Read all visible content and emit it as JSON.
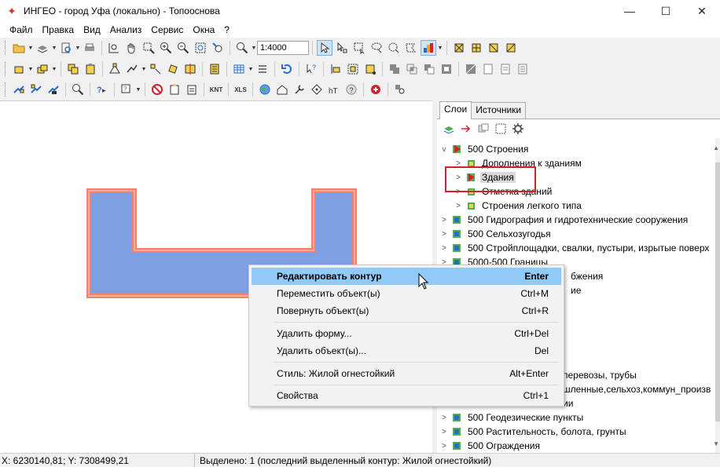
{
  "window": {
    "title": "ИНГЕО - город Уфа (локально) - Топооснова",
    "minimize": "—",
    "maximize": "☐",
    "close": "✕"
  },
  "menu": [
    "Файл",
    "Правка",
    "Вид",
    "Анализ",
    "Сервис",
    "Окна",
    "?"
  ],
  "toolbar": {
    "scale": "1:4000",
    "xls_label": "XLS",
    "knt_label": "KNT"
  },
  "panel": {
    "tabs": [
      "Слои",
      "Источники"
    ],
    "tree": [
      {
        "label": "500 Строения",
        "level": 0,
        "chevron": "down"
      },
      {
        "label": "Дополнения к зданиям",
        "level": 1,
        "chevron": "right"
      },
      {
        "label": "Здания",
        "level": 1,
        "chevron": "right",
        "selected": true
      },
      {
        "label": "Отметка зданий",
        "level": 1,
        "chevron": "right"
      },
      {
        "label": "Строения легкого типа",
        "level": 1,
        "chevron": "right"
      },
      {
        "label": "500 Гидрография и гидротехнические сооружения",
        "level": 0,
        "chevron": "right"
      },
      {
        "label": "500 Сельхозугодья",
        "level": 0,
        "chevron": "right"
      },
      {
        "label": "500 Стройплощадки, свалки, пустыри, изрытые поверх",
        "level": 0,
        "chevron": "right"
      },
      {
        "label": "5000-500 Границы",
        "level": 0,
        "chevron": "right"
      },
      {
        "label": "бжения",
        "level": 0,
        "chevron": "right"
      },
      {
        "label": "ие",
        "level": 0,
        "chevron": "right"
      },
      {
        "label": "",
        "level": 0,
        "chevron": "right"
      },
      {
        "label": "",
        "level": 0,
        "chevron": "right"
      },
      {
        "label": "",
        "level": 0,
        "chevron": "right"
      },
      {
        "label": "перевозы, трубы",
        "level": 0,
        "chevron": "right"
      },
      {
        "label": "шленные,сельхоз,коммун_произв",
        "level": 0,
        "chevron": "right"
      },
      {
        "label": "ии",
        "level": 0,
        "chevron": "right"
      },
      {
        "label": "500 Геодезические пункты",
        "level": 0,
        "chevron": "right"
      },
      {
        "label": "500 Растительность, болота, грунты",
        "level": 0,
        "chevron": "right"
      },
      {
        "label": "500 Ограждения",
        "level": 0,
        "chevron": "right"
      }
    ]
  },
  "context_menu": [
    {
      "label": "Редактировать контур",
      "key": "Enter",
      "hot": true
    },
    {
      "label": "Переместить объект(ы)",
      "key": "Ctrl+M"
    },
    {
      "label": "Повернуть объект(ы)",
      "key": "Ctrl+R"
    },
    {
      "sep": true
    },
    {
      "label": "Удалить форму...",
      "key": "Ctrl+Del"
    },
    {
      "label": "Удалить объект(ы)...",
      "key": "Del"
    },
    {
      "sep": true
    },
    {
      "label": "Стиль: Жилой огнестойкий",
      "key": "Alt+Enter"
    },
    {
      "sep": true
    },
    {
      "label": "Свойства",
      "key": "Ctrl+1"
    }
  ],
  "status": {
    "coords": "X: 6230140,81; Y: 7308499,21",
    "selection": "Выделено: 1 (последний выделенный контур: Жилой огнестойкий)"
  },
  "colors": {
    "building_fill": "#7f9fe3",
    "building_outline": "#f4826a",
    "menu_highlight": "#91c9f7",
    "highlight_box": "#d4202c"
  }
}
